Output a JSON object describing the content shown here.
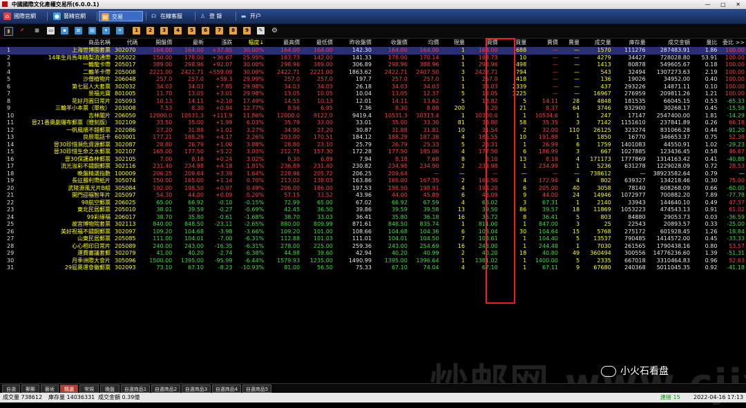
{
  "title": "中國國際文化產權交易所(6.0.0.1)",
  "window_controls": "— ▢ ✕",
  "nav": [
    {
      "label": "國際官網",
      "icon": "home-icon",
      "color": "#e04040"
    },
    {
      "label": "藝精官網",
      "icon": "globe-icon",
      "color": "#3aa0e0"
    },
    {
      "label": "交易",
      "icon": "trade-icon",
      "color": "#e0a030",
      "active": true
    },
    {
      "label": "在線客服",
      "icon": "headset-icon",
      "color": "#aad0ff"
    },
    {
      "label": "登 錄",
      "icon": "person-icon",
      "color": "#aad0ff"
    },
    {
      "label": "开户",
      "icon": "form-icon",
      "color": "#aad0ff"
    }
  ],
  "columns": [
    "",
    "商品名稱",
    "代碼",
    "開盤價",
    "最新",
    "漲跌",
    "幅度↓",
    "最高價",
    "最低價",
    "昨收盤價",
    "收盤價",
    "均價",
    "現量",
    "買價",
    "買量",
    "賣價",
    "賣量",
    "成交量",
    "庫存量",
    "成交金額",
    "量比",
    "委比 >>"
  ],
  "rows": [
    [
      "1",
      "上海世博園套票",
      "302070",
      "164.00",
      "164.00",
      "+37.85",
      "30.00%",
      "164.00",
      "164.00",
      "142.30",
      "164.00",
      "164.00",
      "1",
      "164.00",
      "688",
      "—",
      "—",
      "1570",
      "111276",
      "287483.91",
      "1.86",
      "100.00"
    ],
    [
      "2",
      "14年生肖馬年精梨流通帶",
      "205022",
      "150.00",
      "178.00",
      "+36.67",
      "25.95%",
      "183.73",
      "142.00",
      "141.33",
      "178.00",
      "170.14",
      "1",
      "183.73",
      "10",
      "—",
      "—",
      "4279",
      "34427",
      "728028.80",
      "53.91",
      "100.00"
    ],
    [
      "3",
      "一輪龍卡帶",
      "205017",
      "389.00",
      "298.96",
      "+92.07",
      "30.00%",
      "298.96",
      "389.00",
      "306.89",
      "298.96",
      "388.96",
      "1",
      "298.96",
      "498",
      "—",
      "—",
      "1413",
      "80878",
      "549605.67",
      "0.18",
      "100.00"
    ],
    [
      "4",
      "二輪羊卡帶",
      "205008",
      "2221.00",
      "2422.71",
      "+559.09",
      "30.00%",
      "2422.71",
      "2221.00",
      "1863.62",
      "2422.71",
      "2407.50",
      "3",
      "2422.71",
      "794",
      "—",
      "—",
      "543",
      "32494",
      "1307273.63",
      "2.19",
      "100.00"
    ],
    [
      "5",
      "沙僧植物片",
      "206048",
      "257.0",
      "257.0",
      "+59.3",
      "29.99%",
      "257.0",
      "257.0",
      "197.7",
      "257.0",
      "257.0",
      "1",
      "257.0",
      "418",
      "—",
      "—",
      "136",
      "19026",
      "34952.00",
      "0.40",
      "100.00"
    ],
    [
      "6",
      "第七屆人大套票",
      "302032",
      "34.03",
      "34.03",
      "+7.85",
      "29.98%",
      "34.03",
      "34.03",
      "26.18",
      "34.03",
      "34.03",
      "1",
      "34.03",
      "2339",
      "—",
      "—",
      "437",
      "293226",
      "14871.11",
      "0.10",
      "100.00"
    ],
    [
      "7",
      "景福元寶",
      "801005",
      "11.70",
      "13.05",
      "+3.01",
      "29.98%",
      "13.05",
      "10.05",
      "10.04",
      "13.05",
      "12.37",
      "5",
      "13.05",
      "3225",
      "—",
      "—",
      "16967",
      "276959",
      "209811.26",
      "1.21",
      "100.00"
    ],
    [
      "8",
      "花好月圓日常片",
      "205093",
      "10.13",
      "14.11",
      "+2.10",
      "17.49%",
      "14.55",
      "10.13",
      "12.01",
      "14.11",
      "13.62",
      "5",
      "13.82",
      "5",
      "14.11",
      "28",
      "4848",
      "181535",
      "66045.15",
      "0.53",
      "-65.33"
    ],
    [
      "9",
      "三輪羊小本票（單枚）",
      "203008",
      "7.53",
      "8.30",
      "+0.94",
      "12.77%",
      "9.56",
      "6.95",
      "7.36",
      "8.30",
      "8.08",
      "200",
      "8.20",
      "21",
      "8.37",
      "64",
      "3746",
      "932900",
      "30268.17",
      "0.45",
      "-15.58"
    ],
    [
      "10",
      "吉林關片",
      "206050",
      "12000.0",
      "10531.3",
      "+111.9",
      "11.86%",
      "12000.0",
      "9122.0",
      "9419.4",
      "10531.3",
      "10313.4",
      "1",
      "10300.0",
      "1",
      "10534.6",
      "1",
      "247",
      "17147",
      "2547400.00",
      "1.81",
      "-14.29"
    ],
    [
      "11",
      "晉21番奧劇爆布郵票（贈刻版）",
      "302109",
      "33.50",
      "35.00",
      "+1.99",
      "6.03%",
      "35.79",
      "33.00",
      "33.01",
      "35.00",
      "33.30",
      "81",
      "34.80",
      "58",
      "35.35",
      "3",
      "7142",
      "1151610",
      "237841.89",
      "0.26",
      "66.18"
    ],
    [
      "12",
      "一帆風順不錯郵票",
      "202086",
      "27.20",
      "31.88",
      "+1.01",
      "3.27%",
      "34.90",
      "27.20",
      "30.87",
      "31.88",
      "31.81",
      "10",
      "31.54",
      "2",
      "32.00",
      "110",
      "26125",
      "323274",
      "831066.28",
      "0.44",
      "-91.20"
    ],
    [
      "13",
      "良辰電話卡",
      "603001",
      "177.21",
      "188.29",
      "+4.17",
      "2.26%",
      "203.00",
      "170.51",
      "184.12",
      "188.29",
      "187.38",
      "4",
      "186.55",
      "10",
      "191.88",
      "1",
      "1850",
      "16770",
      "346653.37",
      "0.75",
      "52.38"
    ],
    [
      "14",
      "晉30珍惜瀕危資源郵票",
      "302087",
      "28.80",
      "26.79",
      "+1.00",
      "3.88%",
      "28.80",
      "23.10",
      "25.79",
      "26.79",
      "25.33",
      "5",
      "26.31",
      "1",
      "26.99",
      "6",
      "1759",
      "1401083",
      "44550.91",
      "1.02",
      "-29.23"
    ],
    [
      "15",
      "晉30珍惜生命之水郵票",
      "302107",
      "165.00",
      "177.50",
      "+5.22",
      "3.03%",
      "212.75",
      "157.30",
      "172.28",
      "177.50",
      "185.06",
      "4",
      "177.50",
      "6",
      "186.99",
      "3",
      "667",
      "1027885",
      "123436.45",
      "0.58",
      "46.67"
    ],
    [
      "16",
      "晉30保護森林郵票",
      "302105",
      "7.00",
      "8.18",
      "+0.24",
      "3.02%",
      "8.30",
      "6.89",
      "7.94",
      "8.18",
      "7.68",
      "8",
      "8.10",
      "13",
      "8.18",
      "4",
      "171173",
      "1777869",
      "1314163.42",
      "0.41",
      "-40.88"
    ],
    [
      "17",
      "流光溢彩不鏽鋼郵票",
      "302116",
      "231.40",
      "234.98",
      "+4.18",
      "1.81%",
      "236.89",
      "231.40",
      "230.82",
      "234.98",
      "234.90",
      "2",
      "234.98",
      "1",
      "234.99",
      "1",
      "5236",
      "631278",
      "1229028.09",
      "0.72",
      "28.53"
    ],
    [
      "18",
      "晚盤精選指數",
      "100009",
      "206.25",
      "209.64",
      "+3.39",
      "1.64%",
      "228.96",
      "205.72",
      "206.25",
      "209.64",
      "—",
      "—",
      "—",
      "—",
      "—",
      "—",
      "738612",
      "—",
      "38923582.64",
      "0.79",
      "—"
    ],
    [
      "19",
      "長征勝利帶紙片",
      "305074",
      "150.00",
      "165.00",
      "+1.14",
      "0.70%",
      "213.02",
      "138.03",
      "163.86",
      "165.00",
      "167.35",
      "2",
      "166.50",
      "4",
      "172.94",
      "4",
      "802",
      "639327",
      "134218.46",
      "0.30",
      "75.00"
    ],
    [
      "20",
      "武陵源風光片B組",
      "305084",
      "192.00",
      "198.50",
      "+0.97",
      "0.49%",
      "206.00",
      "186.00",
      "197.53",
      "198.50",
      "198.91",
      "4",
      "194.20",
      "6",
      "205.00",
      "40",
      "3058",
      "78140",
      "608268.09",
      "0.66",
      "-60.00"
    ],
    [
      "21",
      "開門迎福智年片",
      "205097",
      "54.30",
      "44.00",
      "+0.09",
      "0.20%",
      "57.15",
      "33.52",
      "43.96",
      "44.00",
      "45.89",
      "6",
      "43.09",
      "9",
      "44.00",
      "24",
      "14946",
      "1072977",
      "700882.20",
      "7.89",
      "-77.78"
    ],
    [
      "22",
      "98航空郵票",
      "206025",
      "65.00",
      "66.92",
      "-0.10",
      "-0.15%",
      "72.99",
      "65.00",
      "67.02",
      "66.92",
      "67.59",
      "4",
      "66.02",
      "3",
      "67.31",
      "1",
      "2140",
      "33943",
      "144640.10",
      "0.49",
      "47.37"
    ],
    [
      "23",
      "東北民居郵票",
      "205010",
      "38.01",
      "39.59",
      "-0.27",
      "-0.69%",
      "42.45",
      "36.50",
      "39.86",
      "39.59",
      "39.58",
      "13",
      "39.50",
      "86",
      "39.57",
      "18",
      "11869",
      "1053223",
      "474543.13",
      "0.91",
      "61.02"
    ],
    [
      "24",
      "99彩緣福",
      "206017",
      "38.70",
      "35.80",
      "-0.61",
      "-1.68%",
      "38.70",
      "33.03",
      "36.41",
      "35.80",
      "36.18",
      "16",
      "35.72",
      "8",
      "36.41",
      "5",
      "803",
      "84880",
      "29053.73",
      "0.03",
      "-36.59"
    ],
    [
      "25",
      "故宮博物院套票",
      "302113",
      "840.00",
      "848.50",
      "-23.11",
      "-2.65%",
      "880.00",
      "809.99",
      "871.61",
      "848.50",
      "835.74",
      "1",
      "811.00",
      "1",
      "847.00",
      "3",
      "25",
      "22543",
      "20893.57",
      "0.33",
      "-25.00"
    ],
    [
      "26",
      "美好祝福不鏽鋼郵票",
      "302097",
      "109.20",
      "104.68",
      "-3.98",
      "-3.66%",
      "109.20",
      "101.00",
      "108.66",
      "104.68",
      "104.36",
      "6",
      "103.04",
      "30",
      "104.64",
      "15",
      "5768",
      "275172",
      "601928.45",
      "1.26",
      "-18.84"
    ],
    [
      "27",
      "山東民居郵票",
      "205085",
      "111.00",
      "104.01",
      "-7.00",
      "-6.31%",
      "112.88",
      "101.03",
      "111.01",
      "104.01",
      "104.50",
      "7",
      "103.61",
      "1",
      "104.40",
      "5",
      "13537",
      "790485",
      "1414572.00",
      "0.45",
      "-33.33"
    ],
    [
      "28",
      "心心相印日常片",
      "205089",
      "240.00",
      "243.00",
      "-16.35",
      "-6.31%",
      "278.00",
      "225.00",
      "259.36",
      "243.00",
      "254.69",
      "16",
      "243.00",
      "1",
      "244.48",
      "1",
      "7030",
      "261565",
      "1790438.16",
      "0.80",
      "53.57"
    ],
    [
      "29",
      "運費審議套郵",
      "302079",
      "41.00",
      "40.20",
      "-2.74",
      "-6.38%",
      "44.98",
      "39.60",
      "42.94",
      "40.20",
      "40.99",
      "2",
      "40.20",
      "18",
      "40.80",
      "49",
      "360494",
      "300556",
      "14776236.60",
      "1.39",
      "-51.31"
    ],
    [
      "30",
      "月季洲際大會片",
      "305096",
      "1500.00",
      "1395.00",
      "-95.99",
      "-6.44%",
      "1579.93",
      "1235.00",
      "1490.99",
      "1395.00",
      "1396.64",
      "1",
      "1381.02",
      "1",
      "1400.00",
      "5",
      "2335",
      "667018",
      "3310464.83",
      "0.96",
      "52.63"
    ],
    [
      "31",
      "29屆奧運會徽郵票",
      "302093",
      "73.10",
      "67.10",
      "-8.23",
      "-10.93%",
      "81.00",
      "56.50",
      "75.33",
      "67.10",
      "74.04",
      "4",
      "67.10",
      "1",
      "67.11",
      "9",
      "67680",
      "240368",
      "5011045.35",
      "0.92",
      "-41.18"
    ]
  ],
  "bottom_tabs": [
    "自選",
    "郵郵",
    "藝術",
    "精選",
    "常規",
    "晚盤",
    "自選商品1",
    "自選商品2",
    "自選商品3",
    "自選商品4",
    "自選商品5"
  ],
  "active_bottom_tab": "精選",
  "watermark": "炒邮网 www.cjiyou.net",
  "brand": "小火石看盘",
  "status": {
    "volume": "成交量 738612",
    "inventory": "庫存量 14036331",
    "amount": "成交金額 0.39億",
    "link": "連接 15",
    "datetime": "2022-04-16 17:13"
  },
  "colors": {
    "rise": "#ff3b3b",
    "fall": "#34e034",
    "name": "#ffff00",
    "highlight": "#ff1a1a"
  }
}
